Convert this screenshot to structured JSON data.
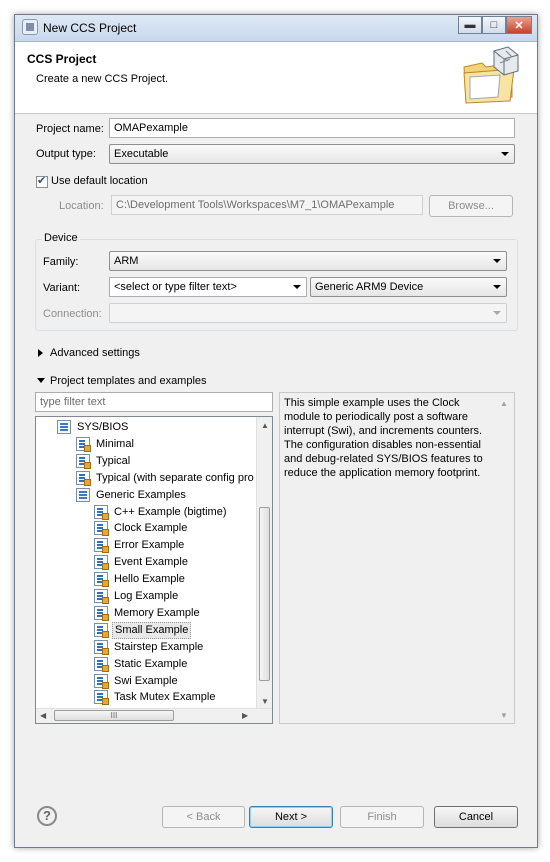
{
  "window": {
    "title": "New CCS Project",
    "minimize_glyph": "▬",
    "maximize_glyph": "□",
    "close_glyph": "✕"
  },
  "header": {
    "title": "CCS Project",
    "description": "Create a new CCS Project."
  },
  "form": {
    "project_name_label": "Project name:",
    "project_name_value": "OMAPexample",
    "output_type_label": "Output type:",
    "output_type_value": "Executable",
    "use_default_location_label": "Use default location",
    "use_default_location_checked": true,
    "location_label": "Location:",
    "location_value": "C:\\Development Tools\\Workspaces\\M7_1\\OMAPexample",
    "browse_label": "Browse..."
  },
  "device": {
    "group_label": "Device",
    "family_label": "Family:",
    "family_value": "ARM",
    "variant_label": "Variant:",
    "variant_filter_value": "<select or type filter text>",
    "variant_value": "Generic ARM9 Device",
    "connection_label": "Connection:",
    "connection_value": ""
  },
  "sections": {
    "advanced_settings": "Advanced settings",
    "templates": "Project templates and examples"
  },
  "templates": {
    "filter_placeholder": "type filter text",
    "items": [
      {
        "label": "SYS/BIOS",
        "icon": "sysbios-folder-icon"
      },
      {
        "label": "Minimal",
        "icon": "template-icon"
      },
      {
        "label": "Typical",
        "icon": "template-icon"
      },
      {
        "label": "Typical (with separate config pro",
        "icon": "template-icon"
      },
      {
        "label": "Generic Examples",
        "icon": "folder-icon"
      },
      {
        "label": "C++ Example (bigtime)",
        "icon": "example-icon"
      },
      {
        "label": "Clock Example",
        "icon": "example-icon"
      },
      {
        "label": "Error Example",
        "icon": "example-icon"
      },
      {
        "label": "Event Example",
        "icon": "example-icon"
      },
      {
        "label": "Hello Example",
        "icon": "example-icon"
      },
      {
        "label": "Log Example",
        "icon": "example-icon"
      },
      {
        "label": "Memory Example",
        "icon": "example-icon"
      },
      {
        "label": "Small Example",
        "icon": "example-icon",
        "selected": true
      },
      {
        "label": "Stairstep Example",
        "icon": "example-icon"
      },
      {
        "label": "Static Example",
        "icon": "example-icon"
      },
      {
        "label": "Swi Example",
        "icon": "example-icon"
      },
      {
        "label": "Task Mutex Example",
        "icon": "example-icon"
      }
    ],
    "hscroll_thumb_glyph": "III",
    "description": "This simple example uses the Clock\nmodule to periodically post a software\ninterrupt (Swi), and increments counters.\nThe configuration disables non-essential\nand debug-related SYS/BIOS features to\nreduce the application memory footprint."
  },
  "buttons": {
    "help_glyph": "?",
    "back": "< Back",
    "next": "Next >",
    "finish": "Finish",
    "cancel": "Cancel"
  }
}
